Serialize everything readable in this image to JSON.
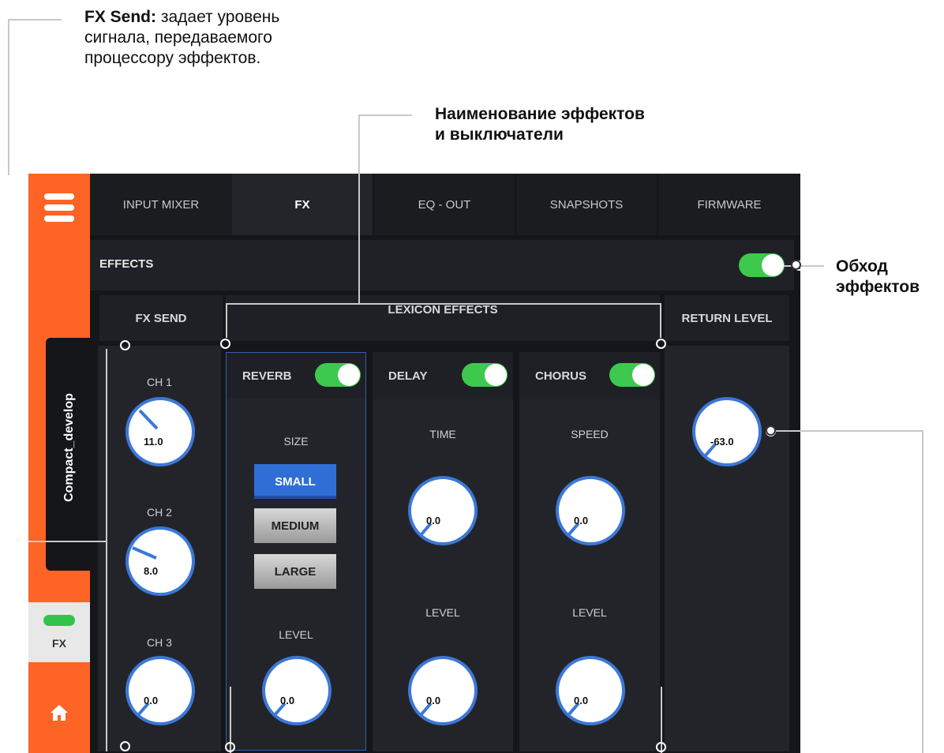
{
  "callouts": {
    "fx_send_bold": "FX Send:",
    "fx_send_text_1": " задает уровень",
    "fx_send_text_2": "сигнала, передаваемого",
    "fx_send_text_3": "процессору эффектов.",
    "names_line_1": "Наименование эффектов",
    "names_line_2": "и выключатели",
    "bypass_line_1": "Обход",
    "bypass_line_2": "эффектов"
  },
  "sidebar": {
    "device_name": "Compact_develop",
    "fx_tab_label": "FX",
    "menu_icon": "hamburger-icon",
    "home_icon": "home-icon"
  },
  "tabs": [
    {
      "label": "INPUT MIXER",
      "active": false
    },
    {
      "label": "FX",
      "active": true
    },
    {
      "label": "EQ - OUT",
      "active": false
    },
    {
      "label": "SNAPSHOTS",
      "active": false
    },
    {
      "label": "FIRMWARE",
      "active": false
    }
  ],
  "effects": {
    "label": "EFFECTS",
    "enabled": true
  },
  "fx_send": {
    "header": "FX SEND",
    "channels": [
      {
        "label": "CH 1",
        "value": "11.0"
      },
      {
        "label": "CH 2",
        "value": "8.0"
      },
      {
        "label": "CH 3",
        "value": "0.0"
      }
    ]
  },
  "lexicon": {
    "header": "LEXICON EFFECTS",
    "reverb": {
      "name": "REVERB",
      "enabled": true,
      "size_label": "SIZE",
      "sizes": [
        "SMALL",
        "MEDIUM",
        "LARGE"
      ],
      "selected_size": "SMALL",
      "level_label": "LEVEL",
      "level_value": "0.0"
    },
    "delay": {
      "name": "DELAY",
      "enabled": true,
      "time_label": "TIME",
      "time_value": "0.0",
      "level_label": "LEVEL",
      "level_value": "0.0"
    },
    "chorus": {
      "name": "CHORUS",
      "enabled": true,
      "speed_label": "SPEED",
      "speed_value": "0.0",
      "level_label": "LEVEL",
      "level_value": "0.0"
    }
  },
  "return_level": {
    "header": "RETURN LEVEL",
    "value": "-63.0"
  },
  "colors": {
    "accent": "#fe6425",
    "toggle_on": "#3dc94e",
    "knob_ring": "#3b78d8",
    "selected_button": "#2f6ed4"
  }
}
